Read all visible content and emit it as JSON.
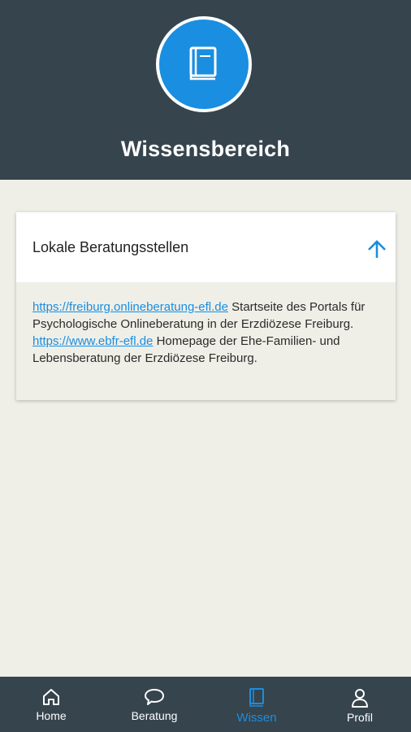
{
  "header": {
    "title": "Wissensbereich",
    "icon": "book-icon"
  },
  "card": {
    "title": "Lokale Beratungsstellen",
    "icon": "arrow-up-icon",
    "entries": [
      {
        "link": "https://freiburg.onlineberatung-efl.de",
        "text": " Startseite des Portals für Psychologische Onlineberatung in der Erzdiözese Freiburg."
      },
      {
        "link": "https://www.ebfr-efl.de",
        "text": " Homepage der Ehe-Familien- und Lebensberatung der Erzdiözese Freiburg."
      }
    ]
  },
  "nav": {
    "items": [
      {
        "label": "Home",
        "icon": "home-icon"
      },
      {
        "label": "Beratung",
        "icon": "chat-bubble-icon"
      },
      {
        "label": "Wissen",
        "icon": "book-icon",
        "active": true
      },
      {
        "label": "Profil",
        "icon": "person-icon"
      }
    ]
  },
  "colors": {
    "header": "#36444d",
    "accent": "#1a8ee0",
    "background": "#efefe8"
  }
}
